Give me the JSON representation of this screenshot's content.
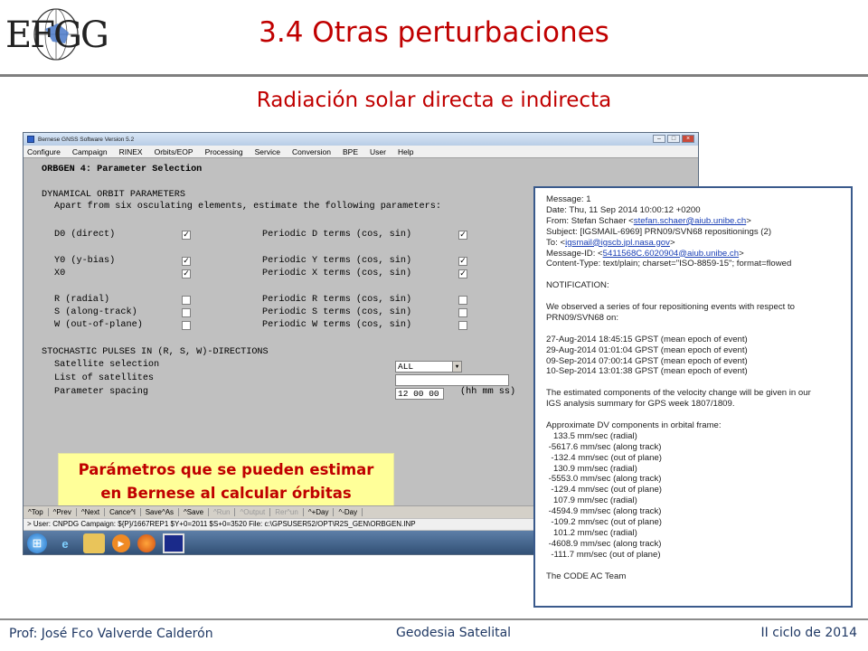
{
  "slide": {
    "logo_text": "EFGG",
    "title": "3.4 Otras perturbaciones",
    "subtitle": "Radiación solar directa e indirecta",
    "highlight_line1": "Parámetros que se pueden estimar",
    "highlight_line2": "en Bernese al calcular órbitas",
    "footer_left": "Prof: José Fco Valverde Calderón",
    "footer_center": "Geodesia Satelital",
    "footer_right": "II ciclo de 2014",
    "title_color": "#c00000",
    "highlight_bg": "#ffff99"
  },
  "bernese": {
    "window_title": "Bernese GNSS Software Version 5.2",
    "menu": [
      "Configure",
      "Campaign",
      "RINEX",
      "Orbits/EOP",
      "Processing",
      "Service",
      "Conversion",
      "BPE",
      "User",
      "Help"
    ],
    "panel_title": "ORBGEN 4: Parameter Selection",
    "dyn_heading": "DYNAMICAL ORBIT PARAMETERS",
    "dyn_intro": "Apart from six osculating elements, estimate the following parameters:",
    "params": [
      {
        "left": "D0 (direct)",
        "left_checked": true,
        "right": "Periodic D terms (cos, sin)",
        "right_checked": true
      },
      {
        "left": "Y0 (y-bias)",
        "left_checked": true,
        "right": "Periodic Y terms (cos, sin)",
        "right_checked": true
      },
      {
        "left": "X0",
        "left_checked": true,
        "right": "Periodic X terms (cos, sin)",
        "right_checked": true
      },
      {
        "left": "R (radial)",
        "left_checked": false,
        "right": "Periodic R terms (cos, sin)",
        "right_checked": false
      },
      {
        "left": "S (along-track)",
        "left_checked": false,
        "right": "Periodic S terms (cos, sin)",
        "right_checked": false
      },
      {
        "left": "W (out-of-plane)",
        "left_checked": false,
        "right": "Periodic W terms (cos, sin)",
        "right_checked": false
      }
    ],
    "stoch_heading": "STOCHASTIC PULSES IN (R, S, W)-DIRECTIONS",
    "sat_selection_label": "Satellite selection",
    "sat_selection_value": "ALL",
    "list_sat_label": "List of satellites",
    "list_sat_value": "",
    "spacing_label": "Parameter spacing",
    "spacing_value": "12 00 00",
    "spacing_unit": "(hh mm ss)",
    "buttons": [
      {
        "label": "^Top",
        "enabled": true
      },
      {
        "label": "^Prev",
        "enabled": true
      },
      {
        "label": "^Next",
        "enabled": true
      },
      {
        "label": "Cance^l",
        "enabled": true
      },
      {
        "label": "Save^As",
        "enabled": true
      },
      {
        "label": "^Save",
        "enabled": true
      },
      {
        "label": "^Run",
        "enabled": false
      },
      {
        "label": "^Output",
        "enabled": false
      },
      {
        "label": "Rer^un",
        "enabled": false
      },
      {
        "label": "^+Day",
        "enabled": true
      },
      {
        "label": "^-Day",
        "enabled": true
      }
    ],
    "status": "> User: CNPDG  Campaign: ${P}/1667REP1  $Y+0=2011  $S+0=3520   File: c:\\GPSUSER52/OPT\\R2S_GEN\\ORBGEN.INP",
    "taskbar_icons": [
      "windows-start-icon",
      "internet-explorer-icon",
      "file-explorer-icon",
      "media-player-icon",
      "firefox-icon",
      "bernese-app-icon"
    ]
  },
  "email": {
    "message": "Message: 1",
    "date": "Date: Thu, 11 Sep 2014 10:00:12 +0200",
    "from_prefix": "From: Stefan Schaer <",
    "from_link": "stefan.schaer@aiub.unibe.ch",
    "from_suffix": ">",
    "subject": "Subject: [IGSMAIL-6969]  PRN09/SVN68 repositionings (2)",
    "to_prefix": "To: <",
    "to_link": "igsmail@igscb.jpl.nasa.gov",
    "to_suffix": ">",
    "msgid_prefix": "Message-ID: <",
    "msgid_link": "5411568C.6020904@aiub.unibe.ch",
    "msgid_suffix": ">",
    "content_type": "Content-Type: text/plain; charset=\"ISO-8859-15\"; format=flowed",
    "notification": "NOTIFICATION:",
    "observed_1": "We observed a series of four repositioning events with respect to",
    "observed_2": "PRN09/SVN68 on:",
    "events": [
      "27-Aug-2014 18:45:15 GPST (mean epoch of event)",
      "29-Aug-2014 01:01:04 GPST (mean epoch of event)",
      "09-Sep-2014 07:00:14 GPST (mean epoch of event)",
      "10-Sep-2014 13:01:38 GPST (mean epoch of event)"
    ],
    "estimated_1": "The estimated components of the velocity change will be given in our",
    "estimated_2": "IGS analysis summary for GPS week 1807/1809.",
    "approx_heading": "Approximate DV components in orbital frame:",
    "components": [
      "   133.5 mm/sec (radial)",
      " -5617.6 mm/sec (along track)",
      "  -132.4 mm/sec (out of plane)",
      "   130.9 mm/sec (radial)",
      " -5553.0 mm/sec (along track)",
      "  -129.4 mm/sec (out of plane)",
      "   107.9 mm/sec (radial)",
      " -4594.9 mm/sec (along track)",
      "  -109.2 mm/sec (out of plane)",
      "   101.2 mm/sec (radial)",
      " -4608.9 mm/sec (along track)",
      "  -111.7 mm/sec (out of plane)"
    ],
    "signature": "The CODE AC Team"
  }
}
